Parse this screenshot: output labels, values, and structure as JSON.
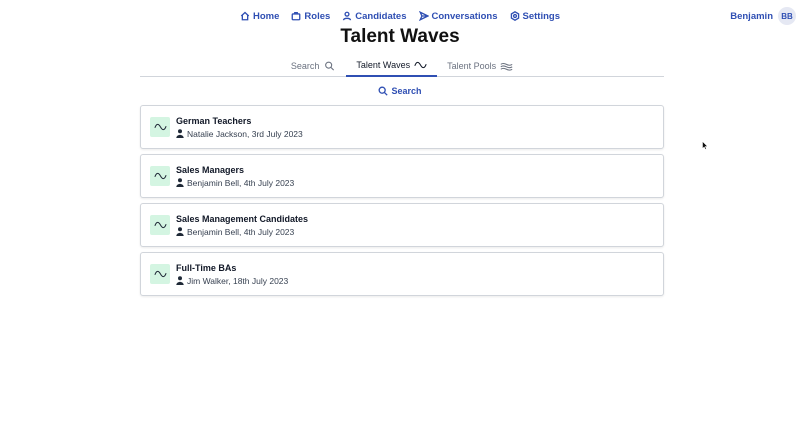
{
  "nav": {
    "items": [
      {
        "label": "Home",
        "icon": "home-icon"
      },
      {
        "label": "Roles",
        "icon": "briefcase-icon"
      },
      {
        "label": "Candidates",
        "icon": "person-icon"
      },
      {
        "label": "Conversations",
        "icon": "send-icon"
      },
      {
        "label": "Settings",
        "icon": "gear-icon"
      }
    ],
    "user_name": "Benjamin",
    "user_initials": "BB"
  },
  "page_title": "Talent Waves",
  "tabs": [
    {
      "label": "Search",
      "icon": "search-icon",
      "active": false
    },
    {
      "label": "Talent Waves",
      "icon": "wave-icon",
      "active": true
    },
    {
      "label": "Talent Pools",
      "icon": "waves-icon",
      "active": false
    }
  ],
  "search_link_label": "Search",
  "waves": [
    {
      "title": "German Teachers",
      "meta": "Natalie Jackson, 3rd July 2023"
    },
    {
      "title": "Sales Managers",
      "meta": "Benjamin Bell, 4th July 2023"
    },
    {
      "title": "Sales Management Candidates",
      "meta": "Benjamin Bell, 4th July 2023"
    },
    {
      "title": "Full-Time BAs",
      "meta": "Jim Walker, 18th July 2023"
    }
  ],
  "colors": {
    "accent": "#2f4fb3",
    "wave_badge_bg": "#d4f5e2",
    "border": "#d1d5db"
  }
}
